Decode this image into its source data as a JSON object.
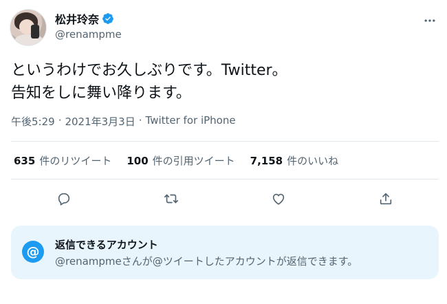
{
  "user": {
    "display_name": "松井玲奈",
    "handle": "@renampme",
    "verified": true
  },
  "tweet": {
    "line1": "というわけでお久しぶりです。Twitter。",
    "line2": "告知をしに舞い降ります。",
    "time": "午後5:29",
    "separator1": "·",
    "date": "2021年3月3日",
    "separator2": "·",
    "source": "Twitter for iPhone"
  },
  "stats": [
    {
      "count": "635",
      "label": "件のリツイート"
    },
    {
      "count": "100",
      "label": "件の引用ツイート"
    },
    {
      "count": "7,158",
      "label": "件のいいね"
    }
  ],
  "actions": [
    "reply-icon",
    "retweet-icon",
    "like-icon",
    "share-icon"
  ],
  "reply_restriction": {
    "icon": "@",
    "title": "返信できるアカウント",
    "description": "@renampmeさんが@ツイートしたアカウントが返信できます。"
  },
  "colors": {
    "accent": "#1d9bf0",
    "secondary_text": "#536471",
    "reply_box_bg": "#e8f5fd"
  }
}
